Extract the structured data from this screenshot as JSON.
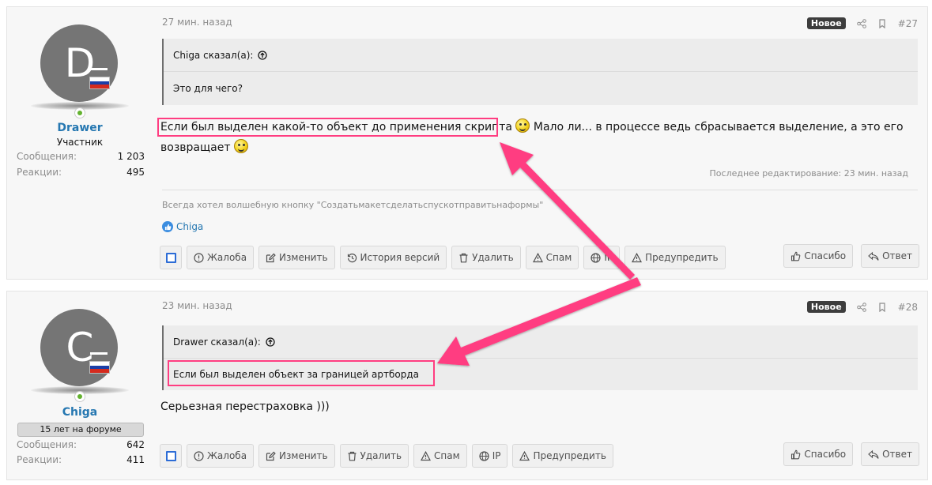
{
  "posts": [
    {
      "avatar_letter": "D",
      "username": "Drawer",
      "user_title": "Участник",
      "stats": [
        {
          "label": "Сообщения:",
          "value": "1 203"
        },
        {
          "label": "Реакции:",
          "value": "495"
        }
      ],
      "time": "27 мин. назад",
      "badge": "Новое",
      "number": "#27",
      "quote": {
        "author": "Chiga сказал(а):",
        "text": "Это для чего?"
      },
      "message_part1": "Если был выделен какой-то объект до применения скрипта",
      "message_part2": " Мало ли... в процессе ведь сбрасывается выделение, а это его",
      "message_part3": "возвращает",
      "edit_note": "Последнее редактирование: 23 мин. назад",
      "signature": "Всегда хотел волшебную кнопку \"Создатьмакетсделатьспускотправитьнаформы\"",
      "reaction_user": "Chiga",
      "actions": [
        "Жалоба",
        "Изменить",
        "История версий",
        "Удалить",
        "Спам",
        "IP",
        "Предупредить"
      ],
      "right_actions": [
        "Спасибо",
        "Ответ"
      ]
    },
    {
      "avatar_letter": "C",
      "username": "Chiga",
      "user_banner": "15 лет на форуме",
      "stats": [
        {
          "label": "Сообщения:",
          "value": "642"
        },
        {
          "label": "Реакции:",
          "value": "411"
        }
      ],
      "time": "23 мин. назад",
      "badge": "Новое",
      "number": "#28",
      "quote": {
        "author": "Drawer сказал(а):",
        "text": "Если был выделен объект за границей артборда"
      },
      "message": "Серьезная перестраховка )))",
      "actions": [
        "Жалоба",
        "Изменить",
        "Удалить",
        "Спам",
        "IP",
        "Предупредить"
      ],
      "right_actions": [
        "Спасибо",
        "Ответ"
      ]
    }
  ],
  "colors": {
    "accent": "#2577b1",
    "highlight": "#ff3d81",
    "badge": "#3d3d3d"
  },
  "icons": [
    "share-icon",
    "bookmark-icon",
    "arrow-up-circle-icon",
    "warning-icon",
    "edit-icon",
    "history-icon",
    "trash-icon",
    "globe-icon",
    "like-icon",
    "reply-icon",
    "checkbox-icon"
  ]
}
